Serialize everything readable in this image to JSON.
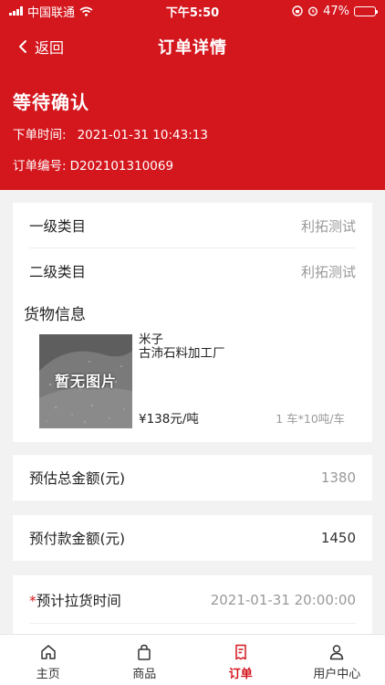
{
  "status_bar": {
    "carrier": "中国联通",
    "time": "下午5:50",
    "battery": "47%",
    "battery_level": 0.47
  },
  "nav": {
    "back_label": "返回",
    "title": "订单详情"
  },
  "order": {
    "status": "等待确认",
    "time_label": "下单时间:",
    "time_value": "2021-01-31 10:43:13",
    "number_label": "订单编号:",
    "number_value": "D202101310069"
  },
  "category": {
    "level1_label": "一级类目",
    "level1_value": "利拓测试",
    "level2_label": "二级类目",
    "level2_value": "利拓测试"
  },
  "goods": {
    "title": "货物信息",
    "image_text": "暂无图片",
    "name": "米子",
    "factory": "古沛石料加工厂",
    "price": "¥138元/吨",
    "spec": "1 车*10吨/车"
  },
  "amounts": {
    "estimated_label": "预估总金额(元)",
    "estimated_value": "1380",
    "prepaid_label": "预付款金额(元)",
    "prepaid_value": "1450"
  },
  "pickup": {
    "required_mark": "*",
    "label": "预计拉货时间",
    "value": "2021-01-31 20:00:00"
  },
  "tabs": [
    {
      "label": "主页",
      "icon": "home-icon"
    },
    {
      "label": "商品",
      "icon": "bag-icon"
    },
    {
      "label": "订单",
      "icon": "order-icon"
    },
    {
      "label": "用户中心",
      "icon": "user-icon"
    }
  ],
  "colors": {
    "brand_red": "#d4161d",
    "muted_text": "#999999"
  }
}
